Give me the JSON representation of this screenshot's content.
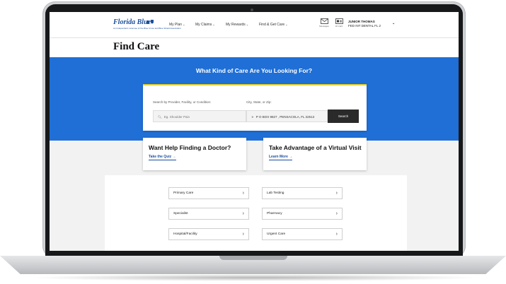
{
  "header": {
    "logo_text": "Florida Blue",
    "logo_tagline": "An Independent Licensee of the Blue Cross and Blue Shield Association",
    "nav": [
      {
        "label": "My Plan"
      },
      {
        "label": "My Claims"
      },
      {
        "label": "My Rewards"
      },
      {
        "label": "Find & Get Care"
      }
    ],
    "messages_label": "Messages",
    "idcard_label": "ID Card",
    "user_name": "JUNIOR THOMAS",
    "user_plan": "FED INT DENTAL FL 2"
  },
  "page": {
    "title": "Find Care"
  },
  "search": {
    "heading": "What Kind of Care Are You Looking For?",
    "provider_label": "Search by Provider, Facility, or Condition:",
    "provider_placeholder": "Eg. Shoulder Pain",
    "location_label": "City, State, or Zip:",
    "location_value": "P O BOX 9827 , PENSACOLA, FL 32513",
    "button": "Search"
  },
  "cards": [
    {
      "title": "Want Help Finding a Doctor?",
      "link": "Take the Quiz →"
    },
    {
      "title": "Take Advantage of a Virtual Visit",
      "link": "Learn More →"
    }
  ],
  "categories": [
    {
      "label": "Primary Care"
    },
    {
      "label": "Lab Testing"
    },
    {
      "label": "Specialist"
    },
    {
      "label": "Pharmacy"
    },
    {
      "label": "Hospital/Facility"
    },
    {
      "label": "Urgent Care"
    }
  ],
  "colors": {
    "brand_blue": "#1f6fd6",
    "accent_yellow": "#e7cf2e",
    "link_blue": "#1a4f9c"
  }
}
